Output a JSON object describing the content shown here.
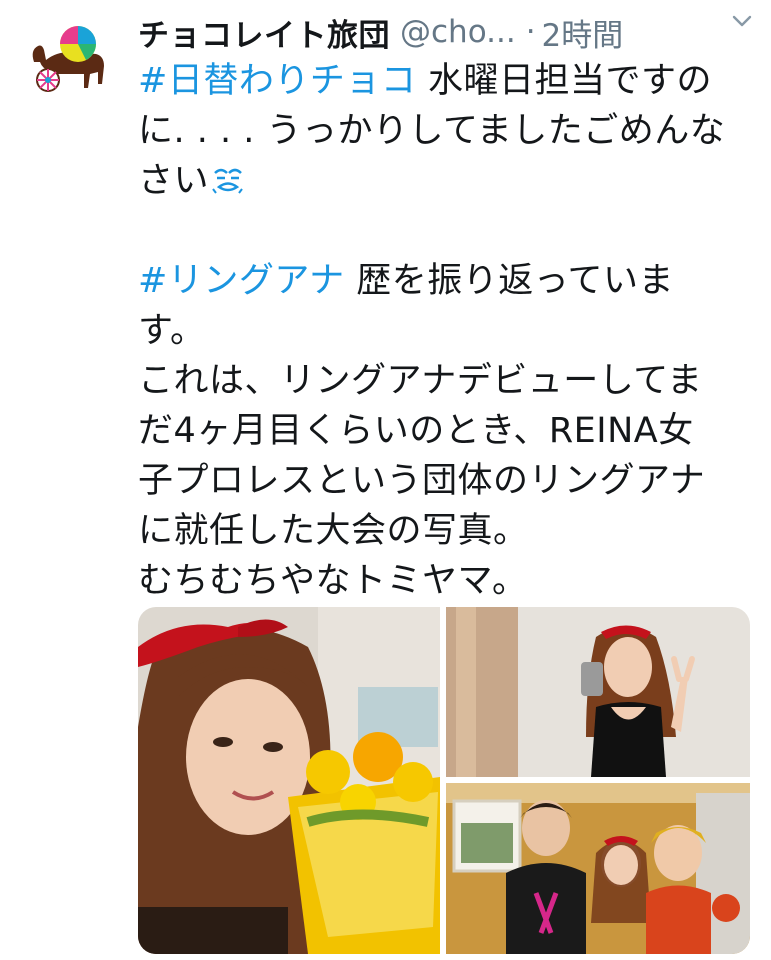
{
  "tweet": {
    "display_name": "チョコレイト旅団",
    "handle": "@cho...",
    "separator": "·",
    "time": "2時間",
    "menu_icon": "chevron-down-icon",
    "avatar_icon": "camel-circus-logo",
    "lines": [
      {
        "hashtag": "#日替わりチョコ",
        "text": " 水曜日担当ですの"
      },
      {
        "text": "に. . . . うっかりしてましたごめんな"
      },
      {
        "text": "さい",
        "emoji": "sweat-face-icon"
      },
      {
        "blank": true
      },
      {
        "hashtag": "#リングアナ",
        "text": " 歴を振り返っていま"
      },
      {
        "text": "す。"
      },
      {
        "text": "これは、リングアナデビューしてま"
      },
      {
        "text": "だ4ヶ月目くらいのとき、REINA女"
      },
      {
        "text": "子プロレスという団体のリングアナ"
      },
      {
        "text": "に就任した大会の写真。"
      },
      {
        "text": "むちむちやなトミヤマ。"
      }
    ],
    "colors": {
      "link": "#1b95e0",
      "text": "#14171a",
      "muted": "#657786"
    }
  },
  "media": {
    "photos": [
      {
        "subject": "woman with red bow holding yellow flower bouquet"
      },
      {
        "subject": "woman in black dress taking mirror selfie with peace sign"
      },
      {
        "subject": "three people posing in a hallway"
      }
    ]
  }
}
